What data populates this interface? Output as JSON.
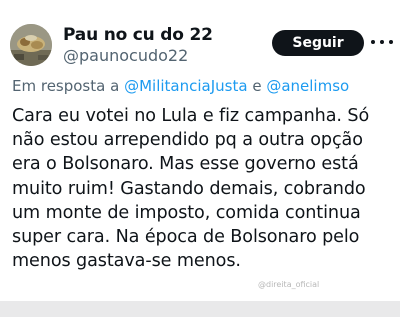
{
  "author": {
    "display_name": "Pau no cu do 22",
    "handle": "@paunocudo22"
  },
  "follow_button": {
    "label": "Seguir"
  },
  "reply_context": {
    "prefix": "Em resposta a",
    "mention_1": "@MilitanciaJusta",
    "conjunction": "e",
    "mention_2": "@anelimso"
  },
  "tweet": {
    "lines": [
      "Cara eu votei no Lula e fiz campanha. Só",
      "não estou arrependido pq a outra opção",
      "era o Bolsonaro. Mas esse governo está",
      "muito ruim! Gastando demais, cobrando",
      "um monte de imposto, comida continua",
      "super cara. Na época de Bolsonaro pelo",
      "menos gastava-se menos."
    ]
  },
  "watermark": "@direita_oficial",
  "icons": {
    "more": "more-horizontal-icon",
    "avatar": "avatar-image"
  },
  "colors": {
    "mention": "#1d9bf0",
    "button_bg": "#0f1419",
    "text": "#0f1419",
    "secondary_text": "#536471"
  }
}
